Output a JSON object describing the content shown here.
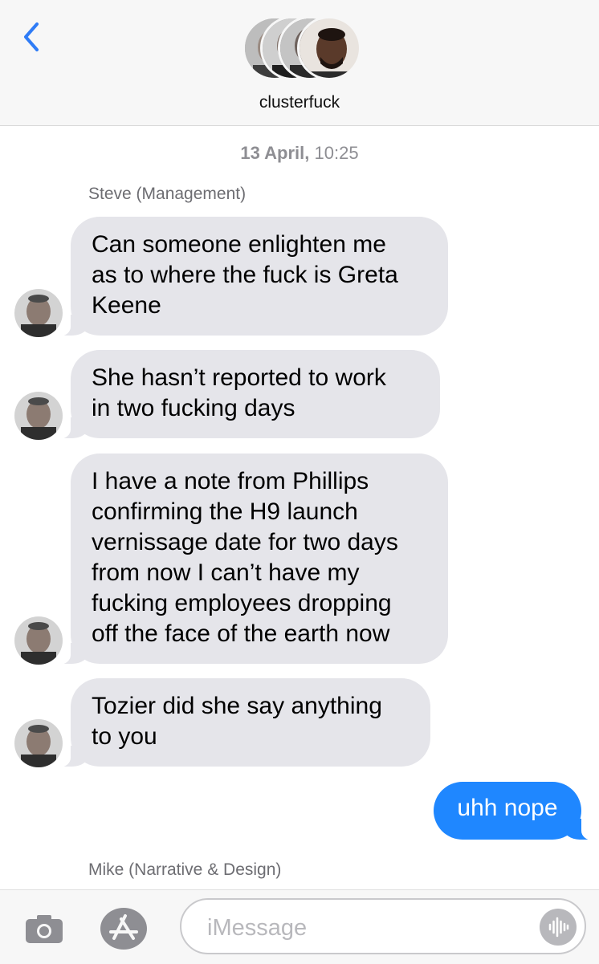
{
  "header": {
    "group_name": "clusterfuck",
    "back_icon": "chevron-left-icon",
    "accent": "#2f7cf6"
  },
  "thread": {
    "timestamp_date": "13 April,",
    "timestamp_time": "10:25",
    "sender_1": "Steve (Management)",
    "messages_in": [
      "Can someone enlighten me\nas to where the fuck is Greta\nKeene",
      "She hasn’t reported to work\nin two fucking days",
      "I have a note from Phillips\nconfirming the H9 launch\nvernissage date for two days\nfrom now I can’t have my\nfucking employees dropping\noff the face of the earth now",
      "Tozier did she say anything\nto you"
    ],
    "message_out": "uhh nope",
    "sender_2": "Mike (Narrative & Design)",
    "outgoing_color": "#1f87ff",
    "incoming_color": "#e5e5ea"
  },
  "composer": {
    "placeholder": "iMessage",
    "camera_icon": "camera-icon",
    "apps_icon": "app-store-icon",
    "audio_icon": "audio-waveform-icon"
  }
}
